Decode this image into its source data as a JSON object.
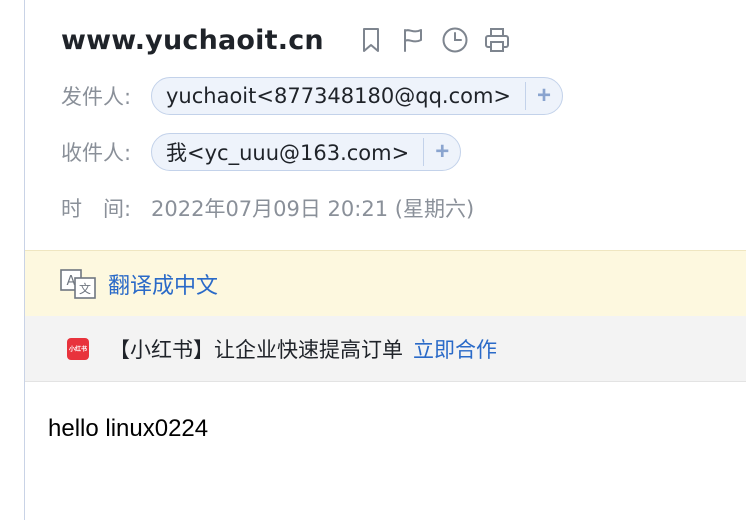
{
  "subject": "www.yuchaoit.cn",
  "toolbar": {
    "icons": [
      "bookmark-icon",
      "flag-icon",
      "clock-icon",
      "print-icon"
    ]
  },
  "sender": {
    "label": "发件人:",
    "name": "yuchaoit",
    "address": "<877348180@qq.com>",
    "add_label": "+"
  },
  "recipient": {
    "label": "收件人:",
    "name": "我",
    "address": "<yc_uuu@163.com>",
    "add_label": "+"
  },
  "time": {
    "label": "时　间:",
    "value": "2022年07月09日 20:21 (星期六)"
  },
  "translate": {
    "icon": "translate-icon",
    "link_label": "翻译成中文"
  },
  "ad": {
    "logo_text": "小红书",
    "text": "【小红书】让企业快速提高订单",
    "link_label": "立即合作"
  },
  "body": {
    "text": "hello linux0224"
  },
  "colors": {
    "link": "#2a6ac8",
    "chip_bg": "#eef3fb",
    "chip_border": "#c3d2ea",
    "translate_bg": "#fdf8df",
    "ad_bg": "#f3f3f3"
  }
}
